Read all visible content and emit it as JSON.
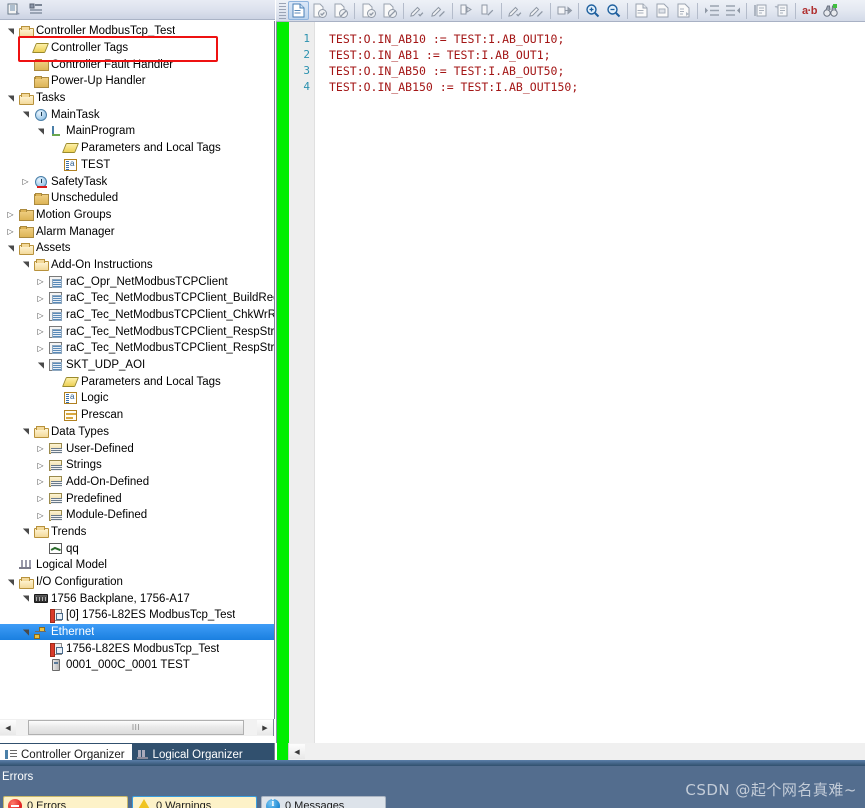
{
  "left_toolbar": {
    "icons": [
      {
        "name": "organizer-view-icon",
        "title": "Organizer View"
      },
      {
        "name": "properties-view-icon",
        "title": "Properties View"
      }
    ]
  },
  "tree": {
    "nodes": [
      {
        "label": "Controller ModbusTcp_Test",
        "indent": 0,
        "expander": "expanded",
        "icon": "folder-open-icon",
        "icon_class": "ic-folder-open",
        "selected": false,
        "name": "tree-item-controller"
      },
      {
        "label": "Controller Tags",
        "indent": 1,
        "expander": "none",
        "icon": "tag-icon",
        "icon_class": "ic-tag",
        "selected": false,
        "name": "tree-item-controller-tags"
      },
      {
        "label": "Controller Fault Handler",
        "indent": 1,
        "expander": "none",
        "icon": "folder-icon",
        "icon_class": "ic-folder-plain",
        "selected": false,
        "name": "tree-item-controller-fault-handler"
      },
      {
        "label": "Power-Up Handler",
        "indent": 1,
        "expander": "none",
        "icon": "folder-icon",
        "icon_class": "ic-folder-plain",
        "selected": false,
        "name": "tree-item-power-up-handler"
      },
      {
        "label": "Tasks",
        "indent": 0,
        "expander": "expanded",
        "icon": "folder-open-icon",
        "icon_class": "ic-folder-open",
        "selected": false,
        "name": "tree-item-tasks"
      },
      {
        "label": "MainTask",
        "indent": 1,
        "expander": "expanded",
        "icon": "clock-icon",
        "icon_class": "ic-clock",
        "selected": false,
        "name": "tree-item-maintask"
      },
      {
        "label": "MainProgram",
        "indent": 2,
        "expander": "expanded",
        "icon": "program-icon",
        "icon_class": "ic-prog",
        "selected": false,
        "name": "tree-item-mainprogram"
      },
      {
        "label": "Parameters and Local Tags",
        "indent": 3,
        "expander": "none",
        "icon": "tag-icon",
        "icon_class": "ic-tag",
        "selected": false,
        "name": "tree-item-parameters-local-tags"
      },
      {
        "label": "TEST",
        "indent": 3,
        "expander": "none",
        "icon": "routine-icon",
        "icon_class": "ic-routine",
        "selected": false,
        "name": "tree-item-routine-test"
      },
      {
        "label": "SafetyTask",
        "indent": 1,
        "expander": "collapsed",
        "icon": "safety-clock-icon",
        "icon_class": "ic-clock safety",
        "selected": false,
        "name": "tree-item-safetytask"
      },
      {
        "label": "Unscheduled",
        "indent": 1,
        "expander": "none",
        "icon": "folder-icon",
        "icon_class": "ic-folder-plain",
        "selected": false,
        "name": "tree-item-unscheduled"
      },
      {
        "label": "Motion Groups",
        "indent": 0,
        "expander": "collapsed",
        "icon": "folder-icon",
        "icon_class": "ic-folder-plain",
        "selected": false,
        "name": "tree-item-motion-groups"
      },
      {
        "label": "Alarm Manager",
        "indent": 0,
        "expander": "collapsed",
        "icon": "folder-icon",
        "icon_class": "ic-folder-plain",
        "selected": false,
        "name": "tree-item-alarm-manager"
      },
      {
        "label": "Assets",
        "indent": 0,
        "expander": "expanded",
        "icon": "folder-open-icon",
        "icon_class": "ic-folder-open",
        "selected": false,
        "name": "tree-item-assets"
      },
      {
        "label": "Add-On Instructions",
        "indent": 1,
        "expander": "expanded",
        "icon": "folder-open-icon",
        "icon_class": "ic-folder-open",
        "selected": false,
        "name": "tree-item-add-on-instructions"
      },
      {
        "label": "raC_Opr_NetModbusTCPClient",
        "indent": 2,
        "expander": "collapsed",
        "icon": "aoi-icon",
        "icon_class": "ic-aoi",
        "selected": false,
        "name": "tree-item-aoi-opr-netmodbustcpclient"
      },
      {
        "label": "raC_Tec_NetModbusTCPClient_BuildReqStr",
        "indent": 2,
        "expander": "collapsed",
        "icon": "aoi-icon",
        "icon_class": "ic-aoi",
        "selected": false,
        "name": "tree-item-aoi-buildreqstr"
      },
      {
        "label": "raC_Tec_NetModbusTCPClient_ChkWrRep",
        "indent": 2,
        "expander": "collapsed",
        "icon": "aoi-icon",
        "icon_class": "ic-aoi",
        "selected": false,
        "name": "tree-item-aoi-chkwrrep"
      },
      {
        "label": "raC_Tec_NetModbusTCPClient_RespStrBit",
        "indent": 2,
        "expander": "collapsed",
        "icon": "aoi-icon",
        "icon_class": "ic-aoi",
        "selected": false,
        "name": "tree-item-aoi-respstrbit"
      },
      {
        "label": "raC_Tec_NetModbusTCPClient_RespStrWd",
        "indent": 2,
        "expander": "collapsed",
        "icon": "aoi-icon",
        "icon_class": "ic-aoi",
        "selected": false,
        "name": "tree-item-aoi-respstrwd"
      },
      {
        "label": "SKT_UDP_AOI",
        "indent": 2,
        "expander": "expanded",
        "icon": "aoi-icon",
        "icon_class": "ic-aoi",
        "selected": false,
        "name": "tree-item-aoi-skt-udp"
      },
      {
        "label": "Parameters and Local Tags",
        "indent": 3,
        "expander": "none",
        "icon": "tag-icon",
        "icon_class": "ic-tag",
        "selected": false,
        "name": "tree-item-aoi-parameters-local-tags"
      },
      {
        "label": "Logic",
        "indent": 3,
        "expander": "none",
        "icon": "routine-icon",
        "icon_class": "ic-routine",
        "selected": false,
        "name": "tree-item-aoi-logic"
      },
      {
        "label": "Prescan",
        "indent": 3,
        "expander": "none",
        "icon": "prescan-icon",
        "icon_class": "ic-prescan",
        "selected": false,
        "name": "tree-item-aoi-prescan"
      },
      {
        "label": "Data Types",
        "indent": 1,
        "expander": "expanded",
        "icon": "folder-open-icon",
        "icon_class": "ic-folder-open",
        "selected": false,
        "name": "tree-item-data-types"
      },
      {
        "label": "User-Defined",
        "indent": 2,
        "expander": "collapsed",
        "icon": "datatype-icon",
        "icon_class": "ic-dt",
        "selected": false,
        "name": "tree-item-user-defined"
      },
      {
        "label": "Strings",
        "indent": 2,
        "expander": "collapsed",
        "icon": "datatype-icon",
        "icon_class": "ic-dt",
        "selected": false,
        "name": "tree-item-strings"
      },
      {
        "label": "Add-On-Defined",
        "indent": 2,
        "expander": "collapsed",
        "icon": "datatype-icon",
        "icon_class": "ic-dt",
        "selected": false,
        "name": "tree-item-add-on-defined"
      },
      {
        "label": "Predefined",
        "indent": 2,
        "expander": "collapsed",
        "icon": "datatype-icon",
        "icon_class": "ic-dt",
        "selected": false,
        "name": "tree-item-predefined"
      },
      {
        "label": "Module-Defined",
        "indent": 2,
        "expander": "collapsed",
        "icon": "datatype-icon",
        "icon_class": "ic-dt",
        "selected": false,
        "name": "tree-item-module-defined"
      },
      {
        "label": "Trends",
        "indent": 1,
        "expander": "expanded",
        "icon": "folder-open-icon",
        "icon_class": "ic-folder-open",
        "selected": false,
        "name": "tree-item-trends"
      },
      {
        "label": "qq",
        "indent": 2,
        "expander": "none",
        "icon": "trend-chart-icon",
        "icon_class": "ic-trend",
        "selected": false,
        "name": "tree-item-trend-qq"
      },
      {
        "label": "Logical Model",
        "indent": 0,
        "expander": "none",
        "icon": "logical-model-icon",
        "icon_class": "ic-logical",
        "selected": false,
        "name": "tree-item-logical-model"
      },
      {
        "label": "I/O Configuration",
        "indent": 0,
        "expander": "expanded",
        "icon": "folder-open-icon",
        "icon_class": "ic-folder-open",
        "selected": false,
        "name": "tree-item-io-configuration"
      },
      {
        "label": "1756 Backplane, 1756-A17",
        "indent": 1,
        "expander": "expanded",
        "icon": "chassis-icon",
        "icon_class": "ic-chassis",
        "selected": false,
        "name": "tree-item-backplane"
      },
      {
        "label": "[0] 1756-L82ES ModbusTcp_Test",
        "indent": 2,
        "expander": "none",
        "icon": "module-icon",
        "icon_class": "ic-module",
        "selected": false,
        "name": "tree-item-module-slot0"
      },
      {
        "label": "Ethernet",
        "indent": 1,
        "expander": "expanded",
        "icon": "ethernet-icon",
        "icon_class": "ic-enet",
        "selected": true,
        "name": "tree-item-ethernet"
      },
      {
        "label": "1756-L82ES ModbusTcp_Test",
        "indent": 2,
        "expander": "none",
        "icon": "module-icon",
        "icon_class": "ic-module",
        "selected": false,
        "name": "tree-item-enet-module"
      },
      {
        "label": "0001_000C_0001 TEST",
        "indent": 2,
        "expander": "none",
        "icon": "device-icon",
        "icon_class": "ic-device",
        "selected": false,
        "name": "tree-item-enet-device-test"
      }
    ]
  },
  "annotation": {
    "target": "Controller Tags",
    "color": "#ee1111"
  },
  "left_scrollbar": {
    "left_arrow": "◀",
    "right_arrow": "▶",
    "grip": "III"
  },
  "organizer_tabs": [
    {
      "label": "Controller Organizer",
      "active": true,
      "icon": "organizer-icon",
      "icon_class": "ic-orgtab",
      "name": "tab-controller-organizer"
    },
    {
      "label": "Logical Organizer",
      "active": false,
      "icon": "logical-organizer-icon",
      "icon_class": "ic-logorg",
      "name": "tab-logical-organizer"
    }
  ],
  "editor_toolbar": {
    "groups": [
      [
        {
          "name": "new-document-icon",
          "kind": "doc",
          "enabled": true,
          "pressed": true
        },
        {
          "name": "verify-document-icon",
          "kind": "doc-check-grey",
          "enabled": false
        },
        {
          "name": "cancel-document-icon",
          "kind": "doc-ban-grey",
          "enabled": false
        }
      ],
      [
        {
          "name": "accept-edits-icon",
          "kind": "doc-check-grey",
          "enabled": false
        },
        {
          "name": "cancel-edits-icon",
          "kind": "doc-ban-grey",
          "enabled": false
        }
      ],
      [
        {
          "name": "accept-pending-edits-icon",
          "kind": "pen-check",
          "enabled": false
        },
        {
          "name": "cancel-pending-edits-icon",
          "kind": "pen-ban",
          "enabled": false
        }
      ],
      [
        {
          "name": "finalize-edits-icon",
          "kind": "flask",
          "enabled": false
        },
        {
          "name": "test-edits-icon",
          "kind": "flask-ban",
          "enabled": false
        }
      ],
      [
        {
          "name": "assemble-edits-icon",
          "kind": "pen-check",
          "enabled": false
        },
        {
          "name": "untest-edits-icon",
          "kind": "pen-ban",
          "enabled": false
        }
      ],
      [
        {
          "name": "export-edits-icon",
          "kind": "arrow-doc",
          "enabled": false
        }
      ],
      [
        {
          "name": "zoom-in-icon",
          "kind": "zoom-in",
          "enabled": true
        },
        {
          "name": "zoom-out-icon",
          "kind": "zoom-out",
          "enabled": true
        }
      ],
      [
        {
          "name": "view-routine-icon",
          "kind": "doc-plain",
          "enabled": false
        },
        {
          "name": "view-tag-icon",
          "kind": "doc-tag",
          "enabled": false
        },
        {
          "name": "view-cross-ref-icon",
          "kind": "doc-ref",
          "enabled": false
        }
      ],
      [
        {
          "name": "indent-increase-icon",
          "kind": "indent-in",
          "enabled": false
        },
        {
          "name": "indent-decrease-icon",
          "kind": "indent-out",
          "enabled": false
        }
      ],
      [
        {
          "name": "comment-block-icon",
          "kind": "comment",
          "enabled": false
        },
        {
          "name": "uncomment-block-icon",
          "kind": "uncomment",
          "enabled": false
        }
      ],
      [
        {
          "name": "find-replace-icon",
          "kind": "text-ab",
          "enabled": true,
          "text": "a·b"
        },
        {
          "name": "browse-logic-icon",
          "kind": "binoculars",
          "enabled": true
        }
      ]
    ],
    "ab_label": "a·b"
  },
  "code": {
    "language": "Structured Text",
    "lines": [
      {
        "num": "1",
        "text": "TEST:O.IN_AB10 := TEST:I.AB_OUT10;"
      },
      {
        "num": "2",
        "text": "TEST:O.IN_AB1 := TEST:I.AB_OUT1;"
      },
      {
        "num": "3",
        "text": "TEST:O.IN_AB50 := TEST:I.AB_OUT50;"
      },
      {
        "num": "4",
        "text": "TEST:O.IN_AB150 := TEST:I.AB_OUT150;"
      }
    ],
    "text_color": "#a31515",
    "line_number_color": "#2b91af",
    "change_bar_color": "#00ee00"
  },
  "errors_panel": {
    "title": "Errors",
    "badges": [
      {
        "kind": "error",
        "icon": "error-icon",
        "label": "0 Errors",
        "name": "badge-errors"
      },
      {
        "kind": "warning",
        "icon": "warning-icon",
        "label": "0 Warnings",
        "name": "badge-warnings"
      },
      {
        "kind": "info",
        "icon": "info-icon",
        "label": "0 Messages",
        "name": "badge-messages"
      }
    ]
  },
  "watermark": {
    "text": "CSDN @起个网名真难~"
  }
}
